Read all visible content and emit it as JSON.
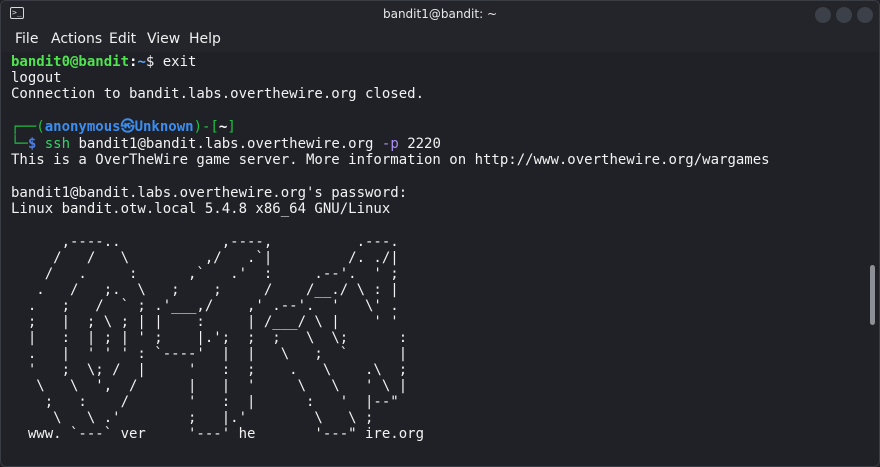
{
  "window": {
    "title": "bandit1@bandit: ~"
  },
  "menu": [
    "File",
    "Actions",
    "Edit",
    "View",
    "Help"
  ],
  "terminal": {
    "l1": {
      "user": "bandit0@bandit",
      "sep": ":",
      "path": "~",
      "rest": "$ exit"
    },
    "l2": "logout",
    "l3": "Connection to bandit.labs.overthewire.org closed.",
    "prompt": {
      "open": "┌──(",
      "user": "anonymous㉿Unknown",
      "mid": ")-[",
      "dir": "~",
      "close": "]",
      "corner": "└─",
      "dollar": "$",
      "cmd": "ssh",
      "host": " bandit1@bandit.labs.overthewire.org ",
      "flag": "-p",
      "port": " 2220"
    },
    "l6": "This is a OverTheWire game server. More information on http://www.overthewire.org/wargames",
    "l8": "bandit1@bandit.labs.overthewire.org's password:",
    "l9": "Linux bandit.otw.local 5.4.8 x86_64 GNU/Linux",
    "art": [
      "      ,----..            ,----,          .---.",
      "     /   /   \\         ,/   .`|         /. ./|",
      "    /   .     :      ,`   .'  :     .--'.  ' ;",
      "   .   /   ;.  \\   ;    ;     /    /__./ \\ : |",
      "  .   ;   /  ` ; .'___,/    ,' .--'.  '   \\' .",
      "  ;   |  ; \\ ; | |    :     | /___/ \\ |    ' '",
      "  |   :  | ; | ' ;    |.';  ;  ;   \\  \\;      :",
      "  .   |  ' ' ' : `----'  |  |   \\   ;  `      |",
      "  '   ;  \\; /  |     '   :  ;    .   \\    .\\  ;",
      "   \\   \\  ',  /      |   |  '     \\   \\   ' \\ |",
      "    ;   :    /       '   :  |      :   '  |--\"",
      "     \\   \\ .'        ;   |.'        \\   \\ ;",
      "  www. `---` ver     '---' he       '---\" ire.org"
    ]
  }
}
